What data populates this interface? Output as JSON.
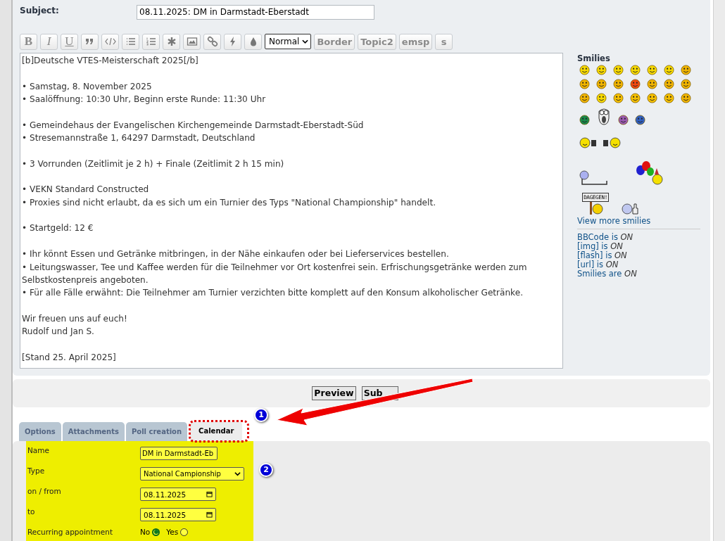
{
  "subject": {
    "label": "Subject:",
    "value": "08.11.2025: DM in Darmstadt-Eberstadt"
  },
  "toolbar": [
    {
      "kind": "text",
      "label": "B"
    },
    {
      "kind": "text",
      "label": "I"
    },
    {
      "kind": "text",
      "label": "U"
    },
    {
      "kind": "icon"
    },
    {
      "kind": "icon"
    },
    {
      "kind": "icon"
    },
    {
      "kind": "icon"
    },
    {
      "kind": "icon"
    },
    {
      "kind": "icon"
    },
    {
      "kind": "icon"
    },
    {
      "kind": "icon"
    },
    {
      "kind": "icon"
    },
    {
      "kind": "select",
      "label": "Normal"
    },
    {
      "kind": "text",
      "label": "Border"
    },
    {
      "kind": "text",
      "label": "Topic2"
    },
    {
      "kind": "text",
      "label": "emsp"
    },
    {
      "kind": "text",
      "label": "s"
    }
  ],
  "message": "[b]Deutsche VTES-Meisterschaft 2025[/b]\n\n• Samstag, 8. November 2025\n• Saalöffnung: 10:30 Uhr, Beginn erste Runde: 11:30 Uhr\n\n• Gemeindehaus der Evangelischen Kirchengemeinde Darmstadt-Eberstadt-Süd\n• Stresemannstraße 1, 64297 Darmstadt, Deutschland\n\n• 3 Vorrunden (Zeitlimit je 2 h) + Finale (Zeitlimit 2 h 15 min)\n\n• VEKN Standard Constructed\n• Proxies sind nicht erlaubt, da es sich um ein Turnier des Typs \"National Championship\" handelt.\n\n• Startgeld: 12 €\n\n• Ihr könnt Essen und Getränke mitbringen, in der Nähe einkaufen oder bei Lieferservices bestellen.\n• Leitungswasser, Tee und Kaffee werden für die Teilnehmer vor Ort kostenfrei sein. Erfrischungsgetränke werden zum Selbstkostenpreis angeboten.\n• Für alle Fälle erwähnt: Die Teilnehmer am Turnier verzichten bitte komplett auf den Konsum alkoholischer Getränke.\n\nWir freuen uns auf euch!\nRudolf und Jan S.\n\n[Stand 25. April 2025]",
  "smilies": {
    "title": "Smilies",
    "rows": [
      [
        {
          "kind": "face",
          "color": "#f5d800"
        },
        {
          "kind": "face",
          "color": "#f5d800"
        },
        {
          "kind": "face",
          "color": "#f5d800"
        },
        {
          "kind": "face",
          "color": "#f5d800"
        },
        {
          "kind": "face",
          "color": "#f5d800"
        },
        {
          "kind": "face",
          "color": "#f5d800"
        },
        {
          "kind": "face",
          "color": "#f0b400"
        }
      ],
      [
        {
          "kind": "face",
          "color": "#f0b400"
        },
        {
          "kind": "face",
          "color": "#f0b400"
        },
        {
          "kind": "face",
          "color": "#f0b400"
        },
        {
          "kind": "face",
          "color": "#f04a10"
        },
        {
          "kind": "face",
          "color": "#f0b400"
        },
        {
          "kind": "face",
          "color": "#f0b400"
        },
        {
          "kind": "face",
          "color": "#f0b400"
        }
      ],
      [
        {
          "kind": "face",
          "color": "#f0b400"
        },
        {
          "kind": "face",
          "color": "#f5d800"
        },
        {
          "kind": "face",
          "color": "#f5c000"
        },
        {
          "kind": "face",
          "color": "#f5c000"
        },
        {
          "kind": "face",
          "color": "#f5c000"
        },
        {
          "kind": "face",
          "color": "#f5c000"
        },
        {
          "kind": "face",
          "color": "#f0b400"
        }
      ],
      [
        {
          "kind": "face",
          "color": "#1a8a4a"
        },
        {
          "kind": "scream"
        },
        {
          "kind": "face",
          "color": "#9a5ab0"
        },
        {
          "kind": "face",
          "color": "#3060c0"
        }
      ],
      [
        {
          "kind": "beer"
        }
      ],
      [
        {
          "kind": "lying"
        },
        {
          "kind": "balloons"
        }
      ],
      [
        {
          "kind": "sign",
          "text": "DAGEGEN!"
        },
        {
          "kind": "thumbs"
        }
      ]
    ],
    "more_link": "View more smilies",
    "status": [
      {
        "name": "BBCode",
        "verb": "is",
        "value": "ON"
      },
      {
        "name": "[img]",
        "verb": "is",
        "value": "ON"
      },
      {
        "name": "[flash]",
        "verb": "is",
        "value": "ON"
      },
      {
        "name": "[url]",
        "verb": "is",
        "value": "ON"
      },
      {
        "name": "Smilies",
        "verb": "are",
        "value": "ON"
      }
    ]
  },
  "buttons": [
    "Preview",
    "Sub"
  ],
  "tabs": [
    {
      "label": "Options",
      "selected": false
    },
    {
      "label": "Attachments",
      "selected": false
    },
    {
      "label": "Poll creation",
      "selected": false
    },
    {
      "label": "Calendar",
      "selected": true
    }
  ],
  "calendar": {
    "fields": [
      {
        "kind": "text",
        "label": "Name",
        "value": "DM in Darmstadt-Eb"
      },
      {
        "kind": "select",
        "label": "Type",
        "value": "National Campionship"
      },
      {
        "kind": "date",
        "label": "on / from",
        "value": "08.11.2025"
      },
      {
        "kind": "date",
        "label": "to",
        "value": "08.11.2025"
      },
      {
        "kind": "radio",
        "label": "Recurring appointment",
        "options": [
          {
            "label": "No",
            "selected": true
          },
          {
            "label": "Yes",
            "selected": false
          }
        ]
      }
    ]
  },
  "annotations": [
    "1",
    "2"
  ]
}
